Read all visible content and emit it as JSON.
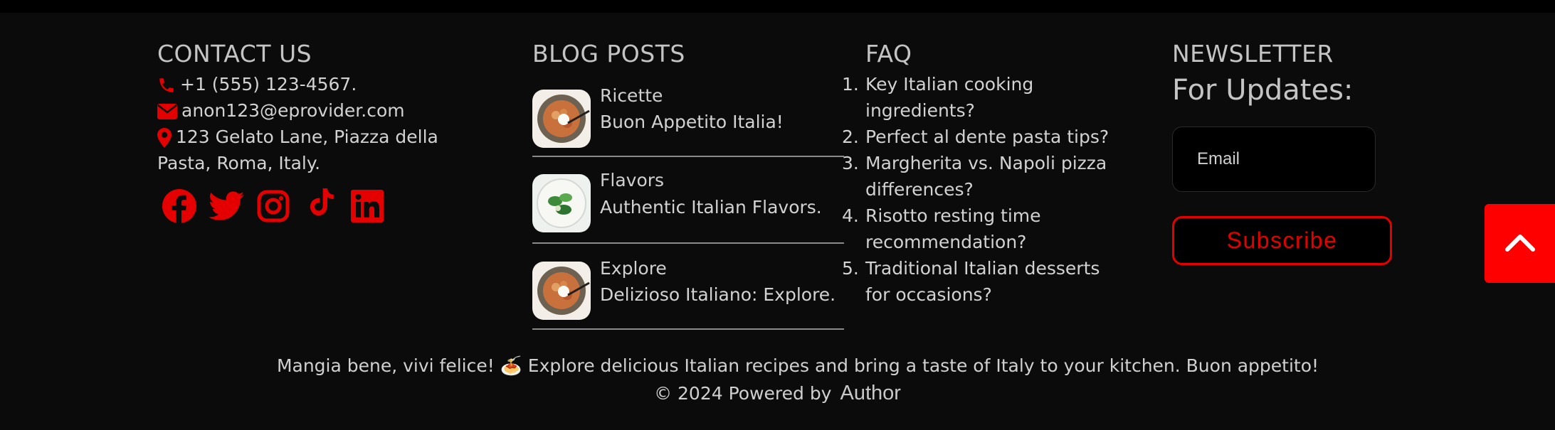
{
  "contact": {
    "heading": "CONTACT US",
    "phone": "+1 (555) 123-4567.",
    "email": "anon123@eprovider.com",
    "address_line1": "123 Gelato Lane, Piazza della",
    "address_line2": "Pasta, Roma, Italy.",
    "icon_color": "#e40000",
    "social": [
      "facebook-icon",
      "twitter-icon",
      "instagram-icon",
      "tiktok-icon",
      "linkedin-icon"
    ]
  },
  "blog": {
    "heading": "BLOG POSTS",
    "posts": [
      {
        "title": "Ricette",
        "subtitle": "Buon Appetito Italia!"
      },
      {
        "title": "Flavors",
        "subtitle": "Authentic Italian Flavors."
      },
      {
        "title": "Explore",
        "subtitle": "Delizioso Italiano: Explore."
      }
    ]
  },
  "faq": {
    "heading": "FAQ",
    "items": [
      {
        "num": "1.",
        "line1": "Key Italian cooking",
        "line2": "ingredients?"
      },
      {
        "num": "2.",
        "line1": "Perfect al dente pasta tips?",
        "line2": ""
      },
      {
        "num": "3.",
        "line1": "Margherita vs. Napoli pizza",
        "line2": "differences?"
      },
      {
        "num": "4.",
        "line1": "Risotto resting time",
        "line2": "recommendation?"
      },
      {
        "num": "5.",
        "line1": "Traditional Italian desserts",
        "line2": "for occasions?"
      }
    ]
  },
  "newsletter": {
    "heading": "NEWSLETTER",
    "subheading": "For Updates:",
    "email_placeholder": "Email",
    "subscribe_label": "Subscribe",
    "accent_color": "#e40000"
  },
  "footer": {
    "tagline": "Mangia bene, vivi felice! 🍝 Explore delicious Italian recipes and bring a taste of Italy to your kitchen. Buon appetito!",
    "copyright": "© 2024 Powered by",
    "author": "Author"
  },
  "back_to_top_icon": "chevron-up-icon"
}
